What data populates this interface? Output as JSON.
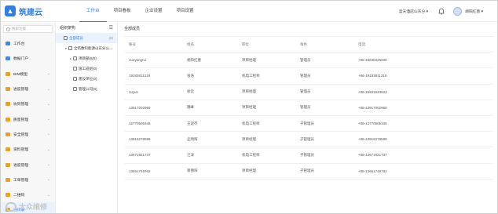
{
  "app": {
    "logo_text": "筑建云"
  },
  "nav": {
    "items": [
      {
        "label": "工作台",
        "active": true
      },
      {
        "label": "项目看板",
        "active": false
      },
      {
        "label": "企业设置",
        "active": false
      },
      {
        "label": "项目设置",
        "active": false
      }
    ]
  },
  "top_right": {
    "project_selector": "蓝天酒店山东分 ▾",
    "user": "胡阳红墨 ▾"
  },
  "sidebar": {
    "search_placeholder": "搜索功能",
    "items": [
      {
        "label": "工作台",
        "color": "#3d8be6",
        "active": false,
        "chevron": false
      },
      {
        "label": "数据门户",
        "color": "#3d8be6",
        "active": false,
        "chevron": false
      },
      {
        "label": "BIM模型",
        "color": "#f0a020",
        "active": false,
        "chevron": true
      },
      {
        "label": "进度管理",
        "color": "#f0a020",
        "active": false,
        "chevron": true
      },
      {
        "label": "协同管理",
        "color": "#f0a020",
        "active": false,
        "chevron": true
      },
      {
        "label": "质量管理",
        "color": "#f0a020",
        "active": false,
        "chevron": true
      },
      {
        "label": "安全管理",
        "color": "#f0a020",
        "active": false,
        "chevron": true
      },
      {
        "label": "资料管理",
        "color": "#f0a020",
        "active": false,
        "chevron": true
      },
      {
        "label": "进度管理",
        "color": "#f0a020",
        "active": false,
        "chevron": true
      },
      {
        "label": "工单管理",
        "color": "#f0a020",
        "active": false,
        "chevron": true
      },
      {
        "label": "二维码",
        "color": "#f0a020",
        "active": false,
        "chevron": true
      },
      {
        "label": "通讯录",
        "color": "#f0a020",
        "active": true,
        "chevron": false
      }
    ]
  },
  "tree": {
    "header": "组织架构",
    "nodes": [
      {
        "label": "全部成员",
        "indent": 0,
        "arrow": "",
        "selected": true,
        "count": "(8)"
      },
      {
        "label": "全筑数科能源山东分公...",
        "indent": 1,
        "arrow": "▾",
        "selected": false,
        "count": ""
      },
      {
        "label": "项目部(8/0)",
        "indent": 2,
        "arrow": "▸",
        "selected": false,
        "count": ""
      },
      {
        "label": "施工班组(0)",
        "indent": 2,
        "arrow": "",
        "selected": false,
        "count": ""
      },
      {
        "label": "建设单位(0)",
        "indent": 2,
        "arrow": "",
        "selected": false,
        "count": ""
      },
      {
        "label": "管理公司(0)",
        "indent": 2,
        "arrow": "",
        "selected": false,
        "count": ""
      }
    ]
  },
  "main": {
    "breadcrumb": "全部成员",
    "columns": [
      "账号",
      "姓名",
      "职位",
      "角色",
      "电话"
    ],
    "rows": [
      [
        "zuoyangrui",
        "胡阳红墨",
        "项目经理",
        "管理员",
        "+86-15638325045"
      ],
      [
        "19183811219",
        "张浩",
        "机电工程师",
        "管理员",
        "+86-19183811219"
      ],
      [
        "zuyun",
        "徐云",
        "项目经理",
        "管理员",
        "+86-15931523623"
      ],
      [
        "13917002969",
        "魏峰",
        "项目经理",
        "管理员",
        "+86-13917002969"
      ],
      [
        "12770505346",
        "王迎杰",
        "机电工程师",
        "子管理员",
        "+86-12770505346"
      ],
      [
        "13916278599",
        "孟明辉",
        "项目经理",
        "子管理员",
        "+86-13916278599"
      ],
      [
        "13671921737",
        "汪洋",
        "机电工程师",
        "子管理员",
        "+86-13671921737"
      ],
      [
        "13651749762",
        "蒋德阳",
        "项目经理",
        "子管理员",
        "+86-13651749762"
      ]
    ]
  },
  "watermark": "大众维修",
  "colors": {
    "accent": "#2f7fe8",
    "active_bg": "#e9f3ff"
  }
}
